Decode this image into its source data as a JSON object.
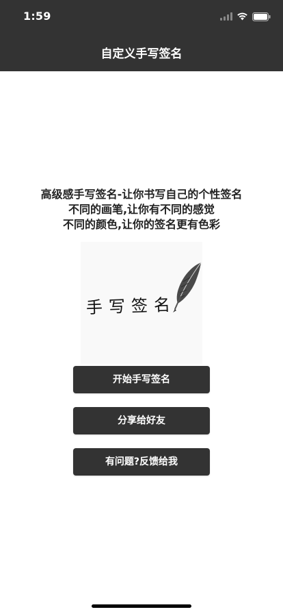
{
  "status_bar": {
    "time": "1:59",
    "icons": [
      "signal-icon",
      "wifi-icon",
      "battery-icon"
    ]
  },
  "nav": {
    "title": "自定义手写签名"
  },
  "intro": {
    "lines": [
      "高级感手写签名-让你书写自己的个性签名",
      "不同的画笔,让你有不同的感觉",
      "不同的颜色,让你的签名更有色彩"
    ]
  },
  "illustration": {
    "text": "手写签名",
    "icon": "quill-pen-icon"
  },
  "buttons": {
    "start": "开始手写签名",
    "share": "分享给好友",
    "feedback": "有问题?反馈给我"
  },
  "colors": {
    "header_bg": "#333333",
    "button_bg": "#333333",
    "text_dark": "#222222",
    "white": "#ffffff"
  }
}
